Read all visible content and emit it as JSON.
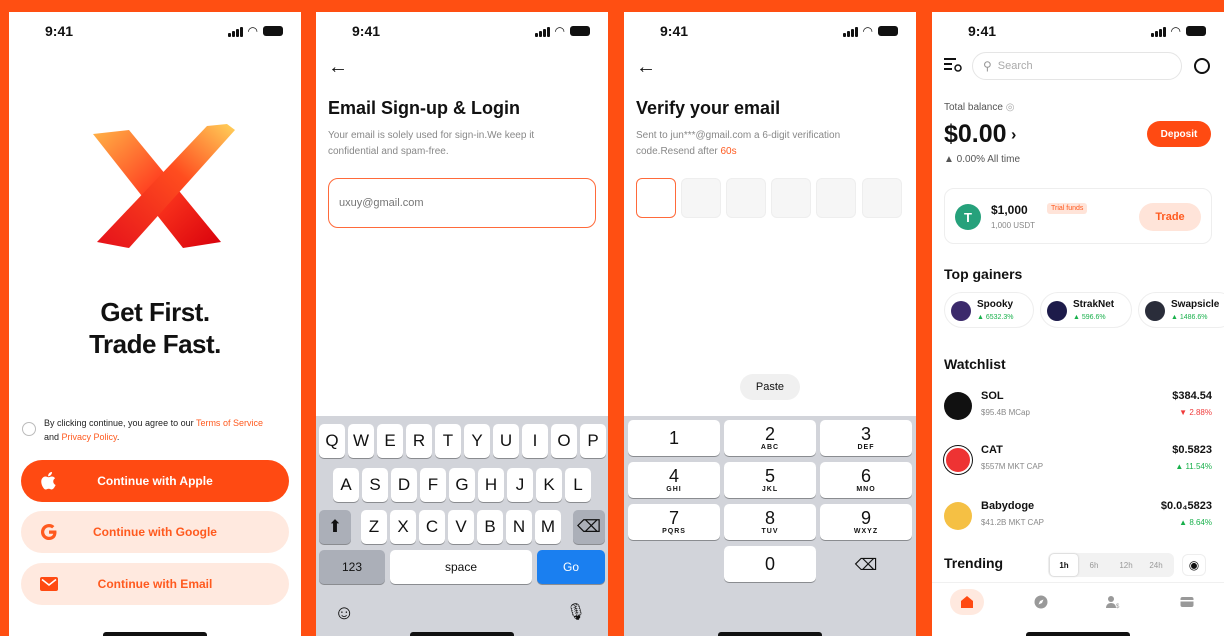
{
  "status": {
    "time": "9:41"
  },
  "onboarding": {
    "headline_1": "Get First.",
    "headline_2": "Trade Fast.",
    "terms_prefix": "By clicking continue, you agree to our ",
    "terms_link": "Terms of Service",
    "terms_and": "and ",
    "privacy_link": "Privacy Policy",
    "terms_suffix": ".",
    "apple_label": "Continue with Apple",
    "google_label": "Continue with Google",
    "email_label": "Continue with Email",
    "colors": {
      "accent": "#ff4a12",
      "accent_light": "#ffe9df"
    }
  },
  "signup": {
    "title": "Email Sign-up & Login",
    "subtitle": "Your email is solely used for sign-in.We keep it confidential and spam-free.",
    "email_placeholder": "uxuy@gmail.com",
    "keyboard": {
      "row1": [
        "Q",
        "W",
        "E",
        "R",
        "T",
        "Y",
        "U",
        "I",
        "O",
        "P"
      ],
      "row2": [
        "A",
        "S",
        "D",
        "F",
        "G",
        "H",
        "J",
        "K",
        "L"
      ],
      "row3": [
        "Z",
        "X",
        "C",
        "V",
        "B",
        "N",
        "M"
      ],
      "numbers_key": "123",
      "space_key": "space",
      "go_key": "Go"
    }
  },
  "verify": {
    "title": "Verify your email",
    "subtitle_prefix": "Sent to jun***@gmail.com a 6-digit verification code.Resend after ",
    "resend_timer": "60s",
    "paste_label": "Paste",
    "numpad": [
      {
        "n": "1",
        "l": ""
      },
      {
        "n": "2",
        "l": "ABC"
      },
      {
        "n": "3",
        "l": "DEF"
      },
      {
        "n": "4",
        "l": "GHI"
      },
      {
        "n": "5",
        "l": "JKL"
      },
      {
        "n": "6",
        "l": "MNO"
      },
      {
        "n": "7",
        "l": "PQRS"
      },
      {
        "n": "8",
        "l": "TUV"
      },
      {
        "n": "9",
        "l": "WXYZ"
      },
      {
        "n": "0",
        "l": ""
      }
    ]
  },
  "home": {
    "search_placeholder": "Search",
    "balance_label": "Total balance",
    "balance": "$0.00",
    "balance_change": "▲ 0.00%  All time",
    "deposit_label": "Deposit",
    "trial": {
      "amount": "$1,000",
      "badge": "Trial funds",
      "sub": "1,000 USDT",
      "trade_label": "Trade"
    },
    "top_gainers_title": "Top gainers",
    "gainers": [
      {
        "name": "Spooky",
        "change": "▲ 6532.3%"
      },
      {
        "name": "StrakNet",
        "change": "▲ 596.6%"
      },
      {
        "name": "Swapsicle",
        "change": "▲ 1486.6%"
      }
    ],
    "watchlist_title": "Watchlist",
    "watchlist": [
      {
        "name": "SOL",
        "cap": "$95.4B MCap",
        "price": "$384.54",
        "change": "▼ 2.88%"
      },
      {
        "name": "CAT",
        "cap": "$557M MKT CAP",
        "price": "$0.5823",
        "change": "▲ 11.54%"
      },
      {
        "name": "Babydoge",
        "cap": "$41.2B MKT CAP",
        "price": "$0.0₄5823",
        "change": "▲ 8.64%"
      }
    ],
    "trending_title": "Trending",
    "timeframes": [
      "1h",
      "6h",
      "12h",
      "24h"
    ]
  }
}
